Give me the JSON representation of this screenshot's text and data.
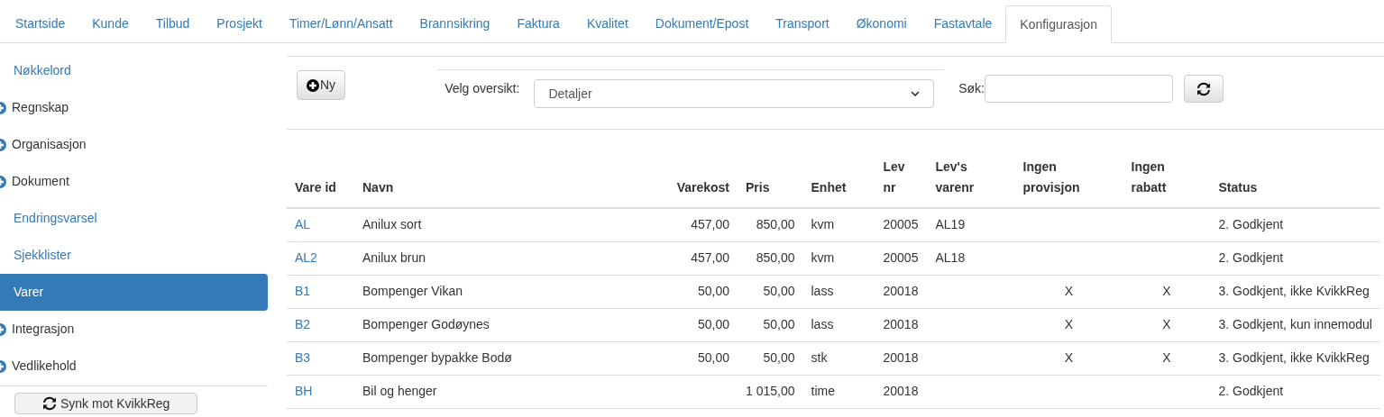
{
  "tabs": [
    {
      "label": "Startside",
      "selected": false
    },
    {
      "label": "Kunde",
      "selected": false
    },
    {
      "label": "Tilbud",
      "selected": false
    },
    {
      "label": "Prosjekt",
      "selected": false
    },
    {
      "label": "Timer/Lønn/Ansatt",
      "selected": false
    },
    {
      "label": "Brannsikring",
      "selected": false
    },
    {
      "label": "Faktura",
      "selected": false
    },
    {
      "label": "Kvalitet",
      "selected": false
    },
    {
      "label": "Dokument/Epost",
      "selected": false
    },
    {
      "label": "Transport",
      "selected": false
    },
    {
      "label": "Økonomi",
      "selected": false
    },
    {
      "label": "Fastavtale",
      "selected": false
    },
    {
      "label": "Konfigurasjon",
      "selected": true
    }
  ],
  "sidebar": {
    "items": [
      {
        "label": "Nøkkelord",
        "kind": "link",
        "selected": false
      },
      {
        "label": "Regnskap",
        "kind": "group",
        "selected": false
      },
      {
        "label": "Organisasjon",
        "kind": "group",
        "selected": false
      },
      {
        "label": "Dokument",
        "kind": "group",
        "selected": false
      },
      {
        "label": "Endringsvarsel",
        "kind": "link",
        "selected": false
      },
      {
        "label": "Sjekklister",
        "kind": "link",
        "selected": false
      },
      {
        "label": "Varer",
        "kind": "link",
        "selected": true
      },
      {
        "label": "Integrasjon",
        "kind": "group",
        "selected": false
      },
      {
        "label": "Vedlikehold",
        "kind": "group",
        "selected": false
      }
    ],
    "sync_button": "Synk mot KvikkReg"
  },
  "toolbar": {
    "new_button": "Ny",
    "view_label": "Velg oversikt:",
    "view_value": "Detaljer",
    "search_label": "Søk:"
  },
  "table": {
    "columns": [
      "Vare id",
      "Navn",
      "Varekost",
      "Pris",
      "Enhet",
      "Lev nr",
      "Lev's varenr",
      "Ingen provisjon",
      "Ingen rabatt",
      "Status"
    ],
    "rows": [
      {
        "id": "AL",
        "name": "Anilux sort",
        "cost": "457,00",
        "price": "850,00",
        "unit": "kvm",
        "supplier": "20005",
        "supplier_item": "AL19",
        "no_commission": "",
        "no_discount": "",
        "status": "2. Godkjent"
      },
      {
        "id": "AL2",
        "name": "Anilux brun",
        "cost": "457,00",
        "price": "850,00",
        "unit": "kvm",
        "supplier": "20005",
        "supplier_item": "AL18",
        "no_commission": "",
        "no_discount": "",
        "status": "2. Godkjent"
      },
      {
        "id": "B1",
        "name": "Bompenger Vikan",
        "cost": "50,00",
        "price": "50,00",
        "unit": "lass",
        "supplier": "20018",
        "supplier_item": "",
        "no_commission": "X",
        "no_discount": "X",
        "status": "3. Godkjent, ikke KvikkReg"
      },
      {
        "id": "B2",
        "name": "Bompenger Godøynes",
        "cost": "50,00",
        "price": "50,00",
        "unit": "lass",
        "supplier": "20018",
        "supplier_item": "",
        "no_commission": "X",
        "no_discount": "X",
        "status": "3. Godkjent, kun innemodul"
      },
      {
        "id": "B3",
        "name": "Bompenger bypakke Bodø",
        "cost": "50,00",
        "price": "50,00",
        "unit": "stk",
        "supplier": "20018",
        "supplier_item": "",
        "no_commission": "X",
        "no_discount": "X",
        "status": "3. Godkjent, ikke KvikkReg"
      },
      {
        "id": "BH",
        "name": "Bil og henger",
        "cost": "",
        "price": "1 015,00",
        "unit": "time",
        "supplier": "20018",
        "supplier_item": "",
        "no_commission": "",
        "no_discount": "",
        "status": "2. Godkjent"
      }
    ]
  }
}
